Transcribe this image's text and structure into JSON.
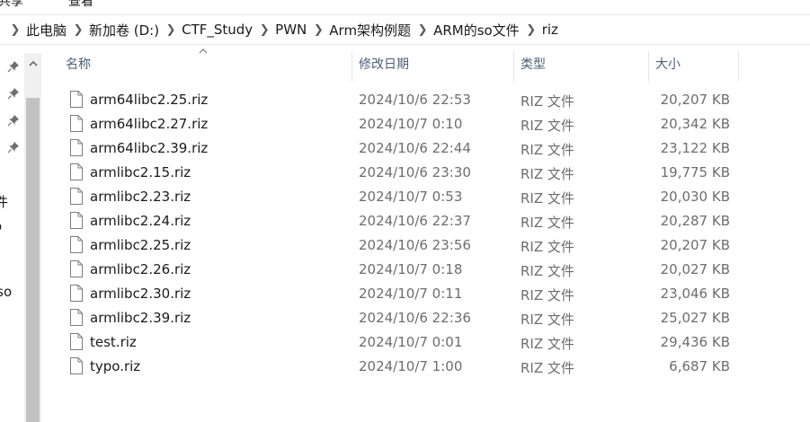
{
  "ribbon": {
    "tabs": [
      "共享",
      "查看"
    ]
  },
  "address": {
    "crumbs": [
      "此电脑",
      "新加卷 (D:)",
      "CTF_Study",
      "PWN",
      "Arm架构例题",
      "ARM的so文件",
      "riz"
    ]
  },
  "nav": {
    "partial_labels": [
      "件",
      "o",
      "rso"
    ]
  },
  "columns": {
    "name": "名称",
    "date": "修改日期",
    "type": "类型",
    "size": "大小"
  },
  "files": [
    {
      "name": "arm64libc2.25.riz",
      "date": "2024/10/6 22:53",
      "type": "RIZ 文件",
      "size": "20,207 KB"
    },
    {
      "name": "arm64libc2.27.riz",
      "date": "2024/10/7 0:10",
      "type": "RIZ 文件",
      "size": "20,342 KB"
    },
    {
      "name": "arm64libc2.39.riz",
      "date": "2024/10/6 22:44",
      "type": "RIZ 文件",
      "size": "23,122 KB"
    },
    {
      "name": "armlibc2.15.riz",
      "date": "2024/10/6 23:30",
      "type": "RIZ 文件",
      "size": "19,775 KB"
    },
    {
      "name": "armlibc2.23.riz",
      "date": "2024/10/7 0:53",
      "type": "RIZ 文件",
      "size": "20,030 KB"
    },
    {
      "name": "armlibc2.24.riz",
      "date": "2024/10/6 22:37",
      "type": "RIZ 文件",
      "size": "20,287 KB"
    },
    {
      "name": "armlibc2.25.riz",
      "date": "2024/10/6 23:56",
      "type": "RIZ 文件",
      "size": "20,207 KB"
    },
    {
      "name": "armlibc2.26.riz",
      "date": "2024/10/7 0:18",
      "type": "RIZ 文件",
      "size": "20,027 KB"
    },
    {
      "name": "armlibc2.30.riz",
      "date": "2024/10/7 0:11",
      "type": "RIZ 文件",
      "size": "23,046 KB"
    },
    {
      "name": "armlibc2.39.riz",
      "date": "2024/10/6 22:36",
      "type": "RIZ 文件",
      "size": "25,027 KB"
    },
    {
      "name": "test.riz",
      "date": "2024/10/7 0:01",
      "type": "RIZ 文件",
      "size": "29,436 KB"
    },
    {
      "name": "typo.riz",
      "date": "2024/10/7 1:00",
      "type": "RIZ 文件",
      "size": "6,687 KB"
    }
  ]
}
